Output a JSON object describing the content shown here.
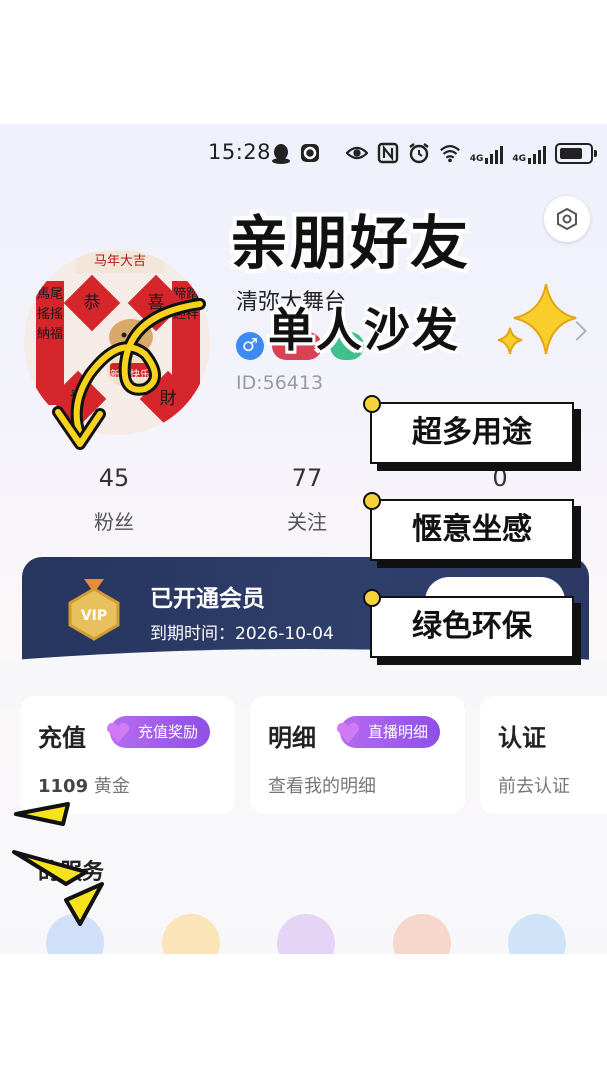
{
  "status_bar": {
    "time": "15:28",
    "network_labels": [
      "4G",
      "4G"
    ]
  },
  "profile": {
    "nickname": "清弥大舞台",
    "gender_symbol": "♂",
    "id_text": "ID:56413",
    "avatar_texts": {
      "banner": "马年大吉",
      "left_couplet": "馬尾搖搖納福",
      "right_couplet": "蹄踏迎祥",
      "fu_left": "恭",
      "fu_right": "喜",
      "fu_bottom_left": "發",
      "fu_bottom_right": "財",
      "sign": "新年快乐"
    }
  },
  "stats": [
    {
      "value": "45",
      "label": "粉丝"
    },
    {
      "value": "77",
      "label": "关注"
    },
    {
      "value": "0",
      "label": ""
    }
  ],
  "vip": {
    "title": "已开通会员",
    "expiry": "到期时间：2026-10-04",
    "medal_text": "VIP"
  },
  "cards": [
    {
      "title": "充值",
      "pill": "充值奖励",
      "sub_value": "1109",
      "sub_unit": "黄金"
    },
    {
      "title": "明细",
      "pill": "直播明细",
      "sub_text": "查看我的明细"
    },
    {
      "title": "认证",
      "sub_text": "前去认证"
    }
  ],
  "services_title": "的服务",
  "overlay": {
    "headline": "亲朋好友",
    "subhead": "单人沙发",
    "tags": [
      "超多用途",
      "惬意坐感",
      "绿色环保"
    ]
  },
  "colors": {
    "vip_bg": "#2b3863",
    "pill_purple": "#9b5cec",
    "tag_dot": "#f5d33a",
    "arrow_yellow": "#f7d21e"
  }
}
